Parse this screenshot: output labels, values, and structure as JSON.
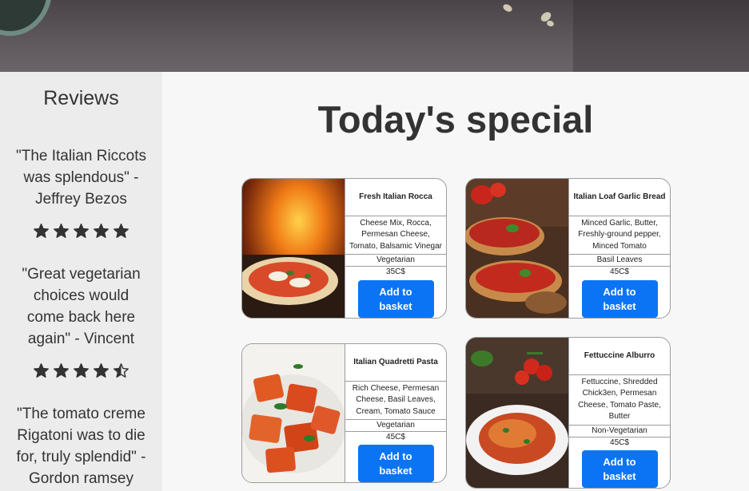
{
  "sidebar": {
    "title": "Reviews",
    "reviews": [
      {
        "text": "\"The Italian Riccots was splendous\" - Jeffrey Bezos",
        "stars": 5
      },
      {
        "text": "\"Great vegetarian choices would come back here again\" - Vincent",
        "stars": 4.5
      },
      {
        "text": "\"The tomato creme Rigatoni was to die for, truly splendid\" - Gordon ramsey",
        "stars": null
      }
    ]
  },
  "main": {
    "title": "Today's special",
    "dishes": [
      {
        "name": "Fresh Italian Rocca",
        "ingredients": "Cheese Mix, Rocca, Permesan Cheese, Tomato, Balsamic Vinegar",
        "diet": "Vegetarian",
        "price": "35C$",
        "button": "Add to basket",
        "photo": "pizza-photo"
      },
      {
        "name": "Italian Loaf Garlic Bread",
        "ingredients": "Minced Garlic, Butter, Freshly-ground pepper, Minced Tomato",
        "diet": "Basil Leaves",
        "price": "45C$",
        "button": "Add to basket",
        "photo": "bruschetta-photo"
      },
      {
        "name": "Italian Quadretti Pasta",
        "ingredients": "Rich Cheese, Permesan Cheese, Basil Leaves, Cream, Tomato Sauce",
        "diet": "Vegetarian",
        "price": "45C$",
        "button": "Add to basket",
        "photo": "ravioli-photo"
      },
      {
        "name": "Fettuccine Alburro",
        "ingredients": "Fettuccine, Shredded Chick3en, Permesan Cheese, Tomato Paste, Butter",
        "diet": "Non-Vegetarian",
        "price": "45C$",
        "button": "Add to basket",
        "photo": "spaghetti-photo"
      }
    ]
  },
  "colors": {
    "button": "#0a74f5",
    "sidebar": "#ececec",
    "star": "#333333"
  }
}
